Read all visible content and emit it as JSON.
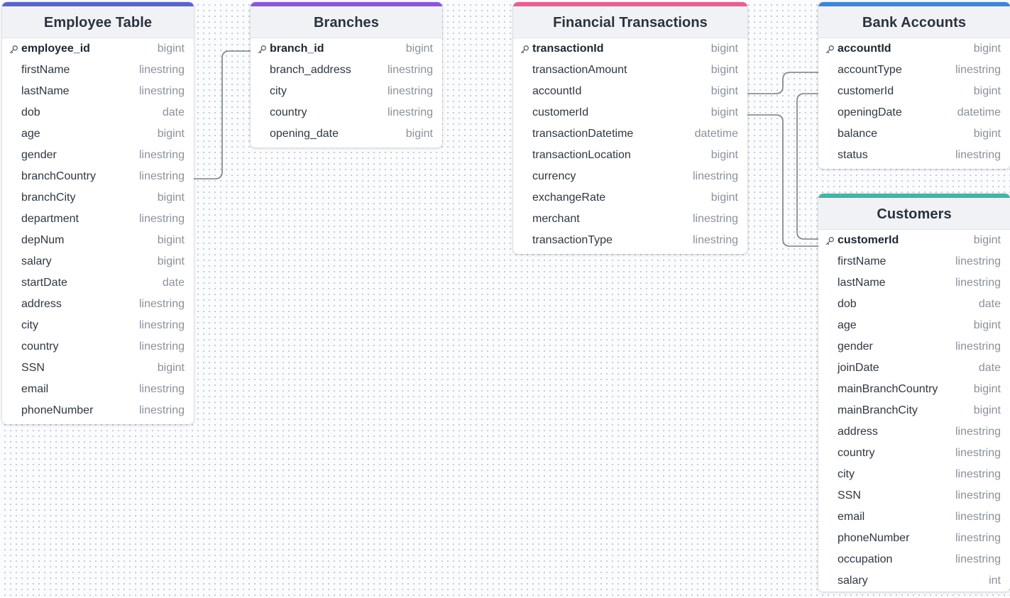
{
  "colors": {
    "employee_accent": "#5a64c9",
    "branches_accent": "#8e55d8",
    "transactions_accent": "#ea5f92",
    "accounts_accent": "#3b86d6",
    "customers_accent": "#43b4a6",
    "connector": "#7a8089"
  },
  "tables": [
    {
      "name": "Employee Table",
      "fields": [
        {
          "name": "employee_id",
          "type": "bigint",
          "pk": true,
          "icon": "key-icon"
        },
        {
          "name": "firstName",
          "type": "linestring"
        },
        {
          "name": "lastName",
          "type": "linestring"
        },
        {
          "name": "dob",
          "type": "date"
        },
        {
          "name": "age",
          "type": "bigint"
        },
        {
          "name": "gender",
          "type": "linestring"
        },
        {
          "name": "branchCountry",
          "type": "linestring"
        },
        {
          "name": "branchCity",
          "type": "bigint"
        },
        {
          "name": "department",
          "type": "linestring"
        },
        {
          "name": "depNum",
          "type": "bigint"
        },
        {
          "name": "salary",
          "type": "bigint"
        },
        {
          "name": "startDate",
          "type": "date"
        },
        {
          "name": "address",
          "type": "linestring"
        },
        {
          "name": "city",
          "type": "linestring"
        },
        {
          "name": "country",
          "type": "linestring"
        },
        {
          "name": "SSN",
          "type": "bigint"
        },
        {
          "name": "email",
          "type": "linestring"
        },
        {
          "name": "phoneNumber",
          "type": "linestring"
        }
      ]
    },
    {
      "name": "Branches",
      "fields": [
        {
          "name": "branch_id",
          "type": "bigint",
          "pk": true,
          "icon": "key-icon"
        },
        {
          "name": "branch_address",
          "type": "linestring"
        },
        {
          "name": "city",
          "type": "linestring"
        },
        {
          "name": "country",
          "type": "linestring"
        },
        {
          "name": "opening_date",
          "type": "bigint"
        }
      ]
    },
    {
      "name": "Financial Transactions",
      "fields": [
        {
          "name": "transactionId",
          "type": "bigint",
          "pk": true,
          "icon": "key-icon"
        },
        {
          "name": "transactionAmount",
          "type": "bigint"
        },
        {
          "name": "accountId",
          "type": "bigint"
        },
        {
          "name": "customerId",
          "type": "bigint"
        },
        {
          "name": "transactionDatetime",
          "type": "datetime"
        },
        {
          "name": "transactionLocation",
          "type": "bigint"
        },
        {
          "name": "currency",
          "type": "linestring"
        },
        {
          "name": "exchangeRate",
          "type": "bigint"
        },
        {
          "name": "merchant",
          "type": "linestring"
        },
        {
          "name": "transactionType",
          "type": "linestring"
        }
      ]
    },
    {
      "name": "Bank Accounts",
      "fields": [
        {
          "name": "accountId",
          "type": "bigint",
          "pk": true,
          "icon": "key-icon"
        },
        {
          "name": "accountType",
          "type": "linestring"
        },
        {
          "name": "customerId",
          "type": "bigint"
        },
        {
          "name": "openingDate",
          "type": "datetime"
        },
        {
          "name": "balance",
          "type": "bigint"
        },
        {
          "name": "status",
          "type": "linestring"
        }
      ]
    },
    {
      "name": "Customers",
      "fields": [
        {
          "name": "customerId",
          "type": "bigint",
          "pk": true,
          "icon": "key-icon"
        },
        {
          "name": "firstName",
          "type": "linestring"
        },
        {
          "name": "lastName",
          "type": "linestring"
        },
        {
          "name": "dob",
          "type": "date"
        },
        {
          "name": "age",
          "type": "bigint"
        },
        {
          "name": "gender",
          "type": "linestring"
        },
        {
          "name": "joinDate",
          "type": "date"
        },
        {
          "name": "mainBranchCountry",
          "type": "bigint"
        },
        {
          "name": "mainBranchCity",
          "type": "bigint"
        },
        {
          "name": "address",
          "type": "linestring"
        },
        {
          "name": "country",
          "type": "linestring"
        },
        {
          "name": "city",
          "type": "linestring"
        },
        {
          "name": "SSN",
          "type": "linestring"
        },
        {
          "name": "email",
          "type": "linestring"
        },
        {
          "name": "phoneNumber",
          "type": "linestring"
        },
        {
          "name": "occupation",
          "type": "linestring"
        },
        {
          "name": "salary",
          "type": "int"
        }
      ]
    }
  ]
}
